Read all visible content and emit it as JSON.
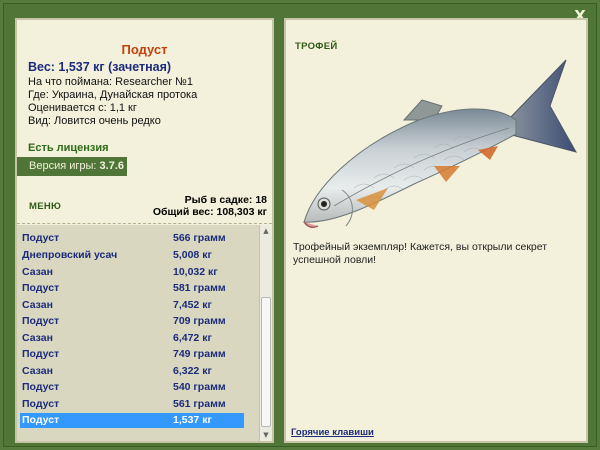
{
  "window": {
    "close_label": "X"
  },
  "fish": {
    "name": "Подуст",
    "weight": "Вес: 1,537 кг (зачетная)",
    "bait": "На что поймана: Researcher №1",
    "location": "Где: Украина, Дунайская протока",
    "value": "Оценивается с: 1,1 кг",
    "kind": "Вид: Ловится очень редко"
  },
  "license": "Есть лицензия",
  "version": {
    "label": "Версия игры:",
    "value": "3.7.6"
  },
  "menu_label": "МЕНЮ",
  "stats": {
    "fish_count": "Рыб в садке: 18",
    "total_weight": "Общий вес: 108,303 кг"
  },
  "catch_list": [
    {
      "name": "Подуст",
      "weight": "566 грамм"
    },
    {
      "name": "Днепровский усач",
      "weight": "5,008 кг"
    },
    {
      "name": "Сазан",
      "weight": "10,032 кг"
    },
    {
      "name": "Подуст",
      "weight": "581 грамм"
    },
    {
      "name": "Сазан",
      "weight": "7,452 кг"
    },
    {
      "name": "Подуст",
      "weight": "709 грамм"
    },
    {
      "name": "Сазан",
      "weight": "6,472 кг"
    },
    {
      "name": "Подуст",
      "weight": "749 грамм"
    },
    {
      "name": "Сазан",
      "weight": "6,322 кг"
    },
    {
      "name": "Подуст",
      "weight": "540 грамм"
    },
    {
      "name": "Подуст",
      "weight": "561 грамм"
    },
    {
      "name": "Подуст",
      "weight": "1,537 кг"
    }
  ],
  "trophy": {
    "label": "ТРОФЕЙ",
    "text": "Трофейный экземпляр! Кажется, вы открыли секрет успешной ловли!"
  },
  "hotkeys_label": "Горячие клавиши",
  "colors": {
    "frame": "#4f7636",
    "panel": "#f3f1dc",
    "title": "#c0420c",
    "link": "#1c2b7a",
    "selection": "#3399ff"
  }
}
